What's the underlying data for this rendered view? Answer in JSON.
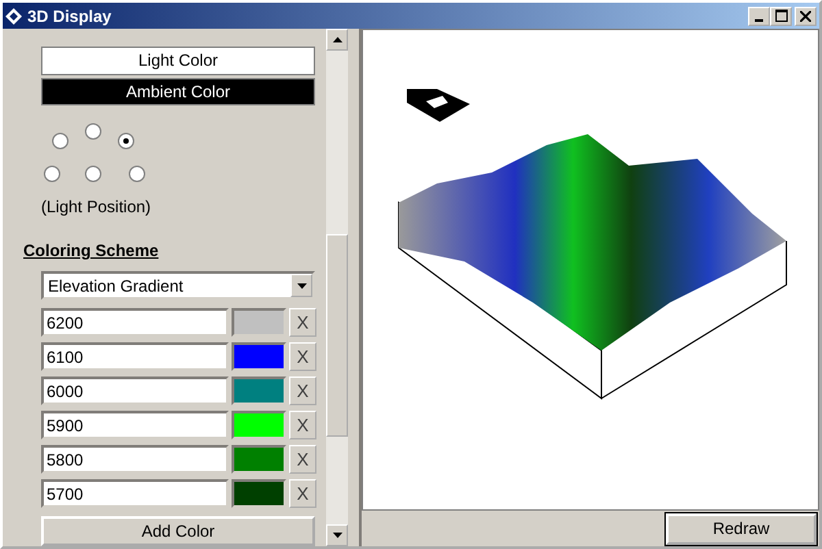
{
  "window": {
    "title": "3D Display"
  },
  "light_buttons": [
    {
      "label": "Light Color",
      "color": "#ffffff"
    },
    {
      "label": "Ambient Color",
      "color": "#000000"
    }
  ],
  "light_positions": [
    {
      "selected": false
    },
    {
      "selected": false
    },
    {
      "selected": true
    },
    {
      "selected": false
    },
    {
      "selected": false
    },
    {
      "selected": false
    }
  ],
  "light_position_label": "(Light Position)",
  "coloring_scheme": {
    "heading": "Coloring Scheme",
    "scheme": "Elevation Gradient",
    "stops": [
      {
        "value": "6200",
        "color": "#c0c0c0",
        "remove": "X"
      },
      {
        "value": "6100",
        "color": "#0000ff",
        "remove": "X"
      },
      {
        "value": "6000",
        "color": "#008080",
        "remove": "X"
      },
      {
        "value": "5900",
        "color": "#00ff00",
        "remove": "X"
      },
      {
        "value": "5800",
        "color": "#008000",
        "remove": "X"
      },
      {
        "value": "5700",
        "color": "#004000",
        "remove": "X"
      }
    ],
    "add_button": "Add Color"
  },
  "redraw_button": "Redraw"
}
